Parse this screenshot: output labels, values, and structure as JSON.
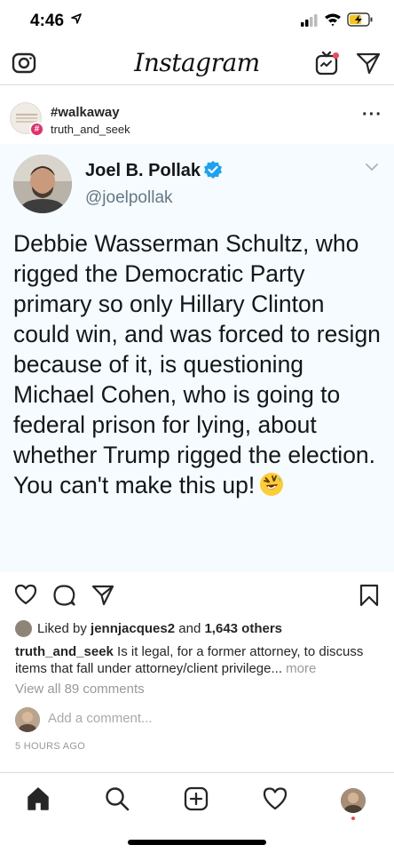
{
  "status_bar": {
    "time": "4:46"
  },
  "nav": {
    "logo": "Instagram"
  },
  "post": {
    "title": "#walkaway",
    "subtitle": "truth_and_seek",
    "badge": "#",
    "more": "···"
  },
  "tweet": {
    "name": "Joel B. Pollak",
    "handle": "@joelpollak",
    "text": "Debbie Wasserman Schultz, who rigged the Democratic Party primary so only Hillary Clinton could win, and was forced to resign because of it, is questioning Michael Cohen, who is going to federal prison for lying, about whether Trump rigged the election. You can't make this up!",
    "emoji": "rolling-on-floor-laughing-emoji"
  },
  "likes": {
    "prefix": "Liked by",
    "user": "jennjacques2",
    "middle": "and",
    "count": "1,643 others"
  },
  "caption": {
    "user": "truth_and_seek",
    "text": " Is it legal, for a former attorney, to discuss items that fall under attorney/client privilege...",
    "more": " more"
  },
  "comments": {
    "view_all": "View all 89 comments",
    "placeholder": "Add a comment..."
  },
  "time_ago": "5 HOURS AGO",
  "colors": {
    "verified": "#1da1f2",
    "accent": "#ed4956",
    "tweet_bg": "#f5fbfe"
  }
}
